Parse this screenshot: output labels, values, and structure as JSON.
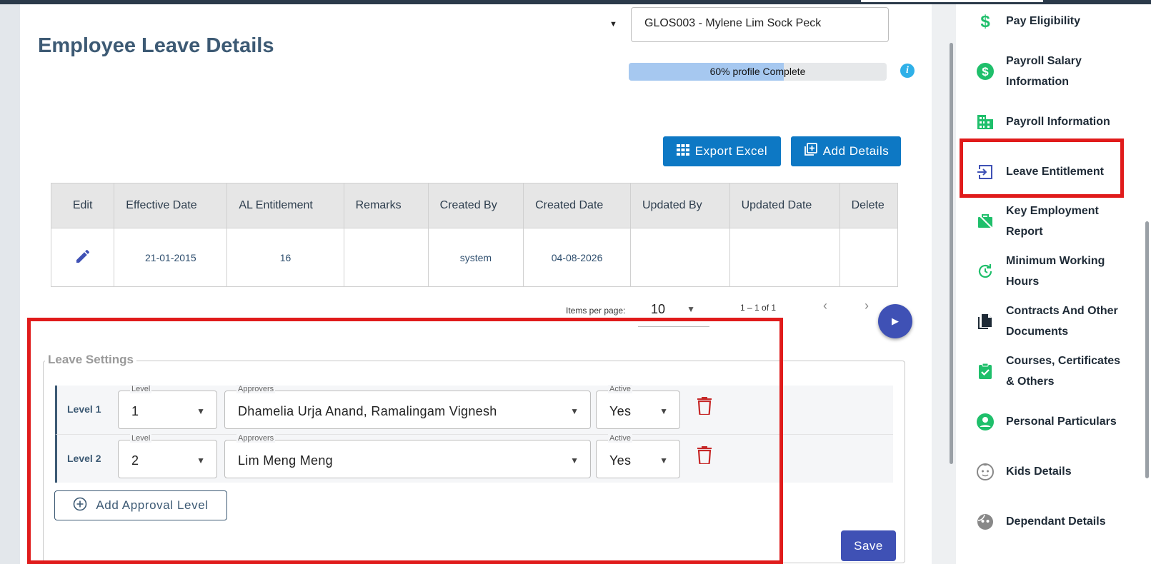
{
  "header": {
    "page_title": "Employee Leave Details",
    "employee_selected": "GLOS003 - Mylene Lim Sock Peck",
    "progress_label": "60% profile Complete",
    "progress_value": 0.6
  },
  "toolbar": {
    "export_label": "Export Excel",
    "add_label": "Add Details"
  },
  "table": {
    "columns": [
      "Edit",
      "Effective Date",
      "AL Entitlement",
      "Remarks",
      "Created By",
      "Created Date",
      "Updated By",
      "Updated Date",
      "Delete"
    ],
    "rows": [
      {
        "effective_date": "21-01-2015",
        "al_entitlement": "16",
        "remarks": "",
        "created_by": "system",
        "created_date": "04-08-2026",
        "updated_by": "",
        "updated_date": ""
      }
    ]
  },
  "paginator": {
    "items_per_page_label": "Items per page:",
    "page_size": "10",
    "range_label": "1 – 1 of 1"
  },
  "leave_settings": {
    "legend": "Leave Settings",
    "field_labels": {
      "level": "Level",
      "approvers": "Approvers",
      "active": "Active"
    },
    "levels": [
      {
        "label": "Level 1",
        "level": "1",
        "approvers": "Dhamelia Urja Anand, Ramalingam Vignesh",
        "active": "Yes"
      },
      {
        "label": "Level 2",
        "level": "2",
        "approvers": "Lim Meng Meng",
        "active": "Yes"
      }
    ],
    "add_level_label": "Add Approval Level",
    "save_label": "Save"
  },
  "sidebar": {
    "items": [
      {
        "label": "Pay Eligibility",
        "icon": "dollar-icon"
      },
      {
        "label": "Payroll Salary Information",
        "icon": "dollar-circle-icon"
      },
      {
        "label": "Payroll Information",
        "icon": "building-icon"
      },
      {
        "label": "Leave Entitlement",
        "icon": "login-icon"
      },
      {
        "label": "Key Employment Report",
        "icon": "briefcase-off-icon"
      },
      {
        "label": "Minimum Working Hours",
        "icon": "clock-history-icon"
      },
      {
        "label": "Contracts And Other Documents",
        "icon": "documents-icon"
      },
      {
        "label": "Courses, Certificates & Others",
        "icon": "clipboard-check-icon"
      },
      {
        "label": "Personal Particulars",
        "icon": "account-circle-icon"
      },
      {
        "label": "Kids Details",
        "icon": "child-face-icon"
      },
      {
        "label": "Dependant Details",
        "icon": "face-icon"
      }
    ]
  },
  "colors": {
    "accent_blue": "#0d78c4",
    "primary_indigo": "#3f51b5",
    "highlight_red": "#e01b1b",
    "sidebar_icon_green": "#1fbf6b"
  }
}
